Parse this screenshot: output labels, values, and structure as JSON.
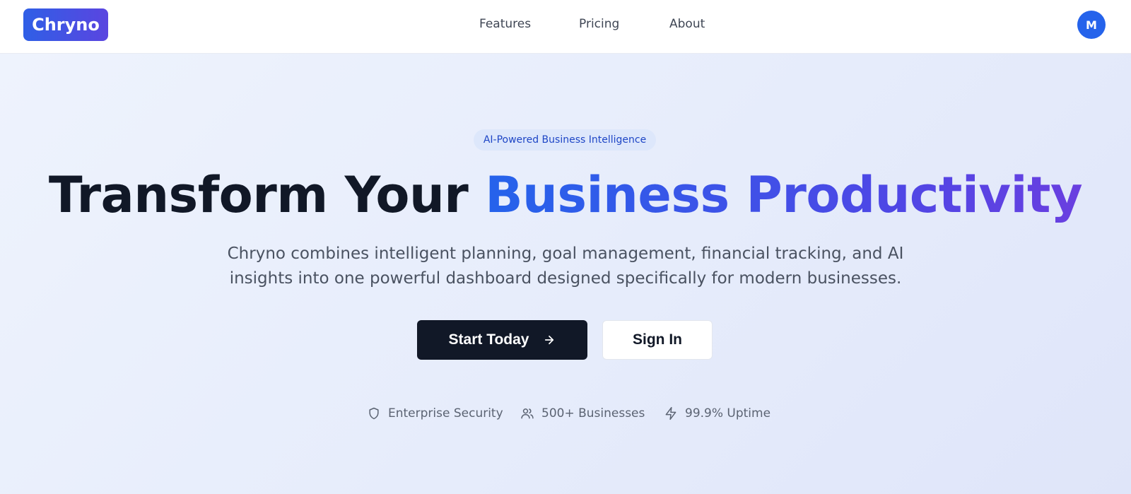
{
  "brand": {
    "name": "Chryno"
  },
  "nav": {
    "links": [
      "Features",
      "Pricing",
      "About"
    ],
    "avatar_initial": "M"
  },
  "hero": {
    "badge": "AI-Powered Business Intelligence",
    "headline_lead": "Transform Your ",
    "headline_accent": "Business Productivity",
    "subtitle": "Chryno combines intelligent planning, goal management, financial tracking, and AI insights into one powerful dashboard designed specifically for modern businesses.",
    "primary_cta": "Start Today",
    "secondary_cta": "Sign In",
    "trust": [
      {
        "icon": "shield-icon",
        "label": "Enterprise Security"
      },
      {
        "icon": "users-icon",
        "label": "500+ Businesses"
      },
      {
        "icon": "lightning-icon",
        "label": "99.9% Uptime"
      }
    ]
  },
  "colors": {
    "brand_gradient_start": "#2f5fe6",
    "brand_gradient_end": "#5a45e0",
    "accent_blue": "#2563eb",
    "accent_indigo": "#4f46e5",
    "dark": "#111827",
    "hero_bg": "#e8eefb"
  }
}
